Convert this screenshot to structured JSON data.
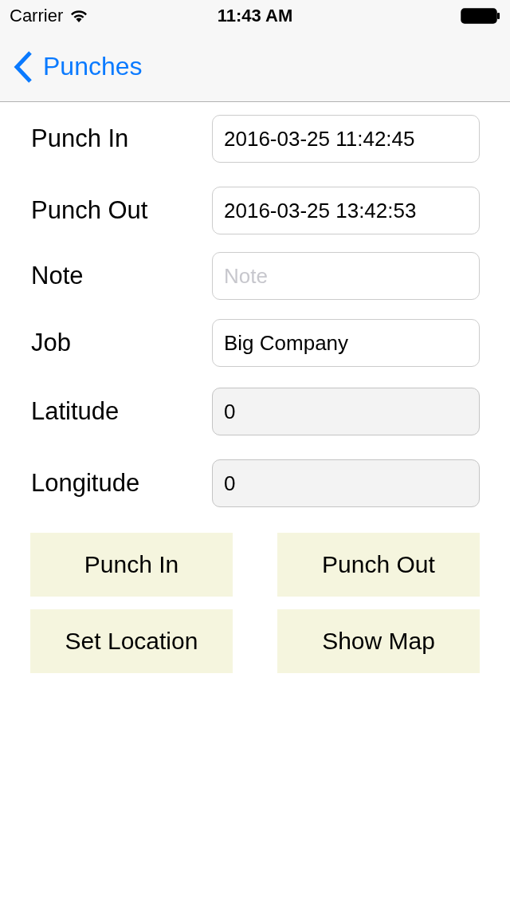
{
  "status_bar": {
    "carrier": "Carrier",
    "time": "11:43 AM"
  },
  "nav": {
    "back": "Punches"
  },
  "fields": [
    {
      "label": "Punch In",
      "value": "2016-03-25 11:42:45",
      "disabled": false
    },
    {
      "label": "Punch Out",
      "value": "2016-03-25 13:42:53",
      "disabled": false
    },
    {
      "label": "Note",
      "placeholder": "Note",
      "disabled": false
    },
    {
      "label": "Job",
      "value": "Big Company",
      "disabled": false
    },
    {
      "label": "Latitude",
      "value": "0",
      "disabled": true
    },
    {
      "label": "Longitude",
      "value": "0",
      "disabled": true
    }
  ],
  "buttons": [
    "Punch In",
    "Punch Out",
    "Set Location",
    "Show Map"
  ]
}
